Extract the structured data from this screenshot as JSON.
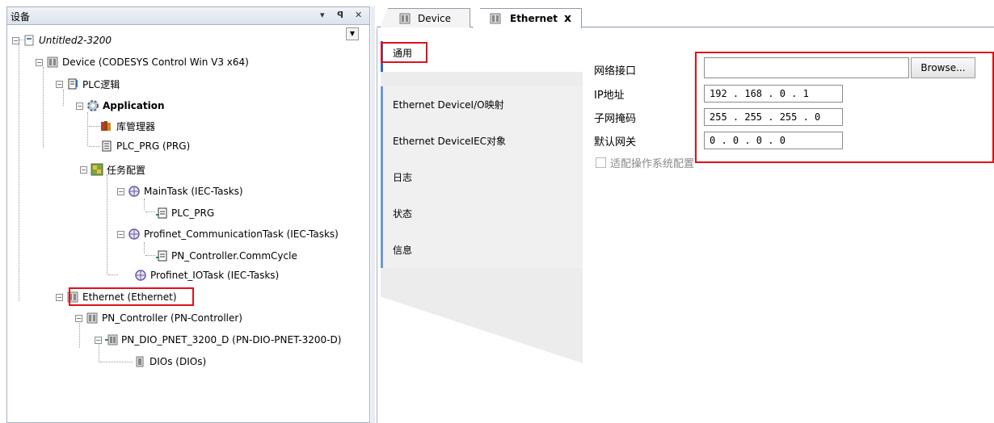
{
  "left_panel": {
    "title": "设备",
    "header_controls": {
      "menu": "▾",
      "pin": "ᵖ",
      "close": "✕"
    },
    "tree": {
      "project": "Untitled2-3200",
      "device": "Device (CODESYS Control Win V3 x64)",
      "plc_logic": "PLC逻辑",
      "application": "Application",
      "library_manager": "库管理器",
      "plc_prg": "PLC_PRG (PRG)",
      "task_config": "任务配置",
      "main_task": "MainTask (IEC-Tasks)",
      "main_task_call": "PLC_PRG",
      "comm_task": "Profinet_CommunicationTask (IEC-Tasks)",
      "comm_task_call": "PN_Controller.CommCycle",
      "io_task": "Profinet_IOTask (IEC-Tasks)",
      "ethernet": "Ethernet (Ethernet)",
      "pn_controller": "PN_Controller (PN-Controller)",
      "pn_dio": "PN_DIO_PNET_3200_D (PN-DIO-PNET-3200-D)",
      "dios": "DIOs (DIOs)"
    }
  },
  "editor": {
    "tabs": [
      {
        "label": "Device",
        "active": false
      },
      {
        "label": "Ethernet",
        "active": true,
        "close": "x"
      }
    ],
    "side_tabs": [
      "通用",
      "Ethernet DeviceI/O映射",
      "Ethernet DeviceIEC对象",
      "日志",
      "状态",
      "信息"
    ],
    "form": {
      "network_interface_label": "网络接口",
      "network_interface_value": "",
      "browse_label": "Browse...",
      "ip_label": "IP地址",
      "ip_value": "192 . 168 .  0  .  1",
      "subnet_label": "子网掩码",
      "subnet_value": "255 . 255 . 255 .  0",
      "gateway_label": "默认网关",
      "gateway_value": " 0  .  0  .  0  .  0",
      "adapt_os_label": "适配操作系统配置"
    }
  },
  "colors": {
    "highlight": "#e0101a",
    "tab_accent": "#2e6fc0"
  }
}
